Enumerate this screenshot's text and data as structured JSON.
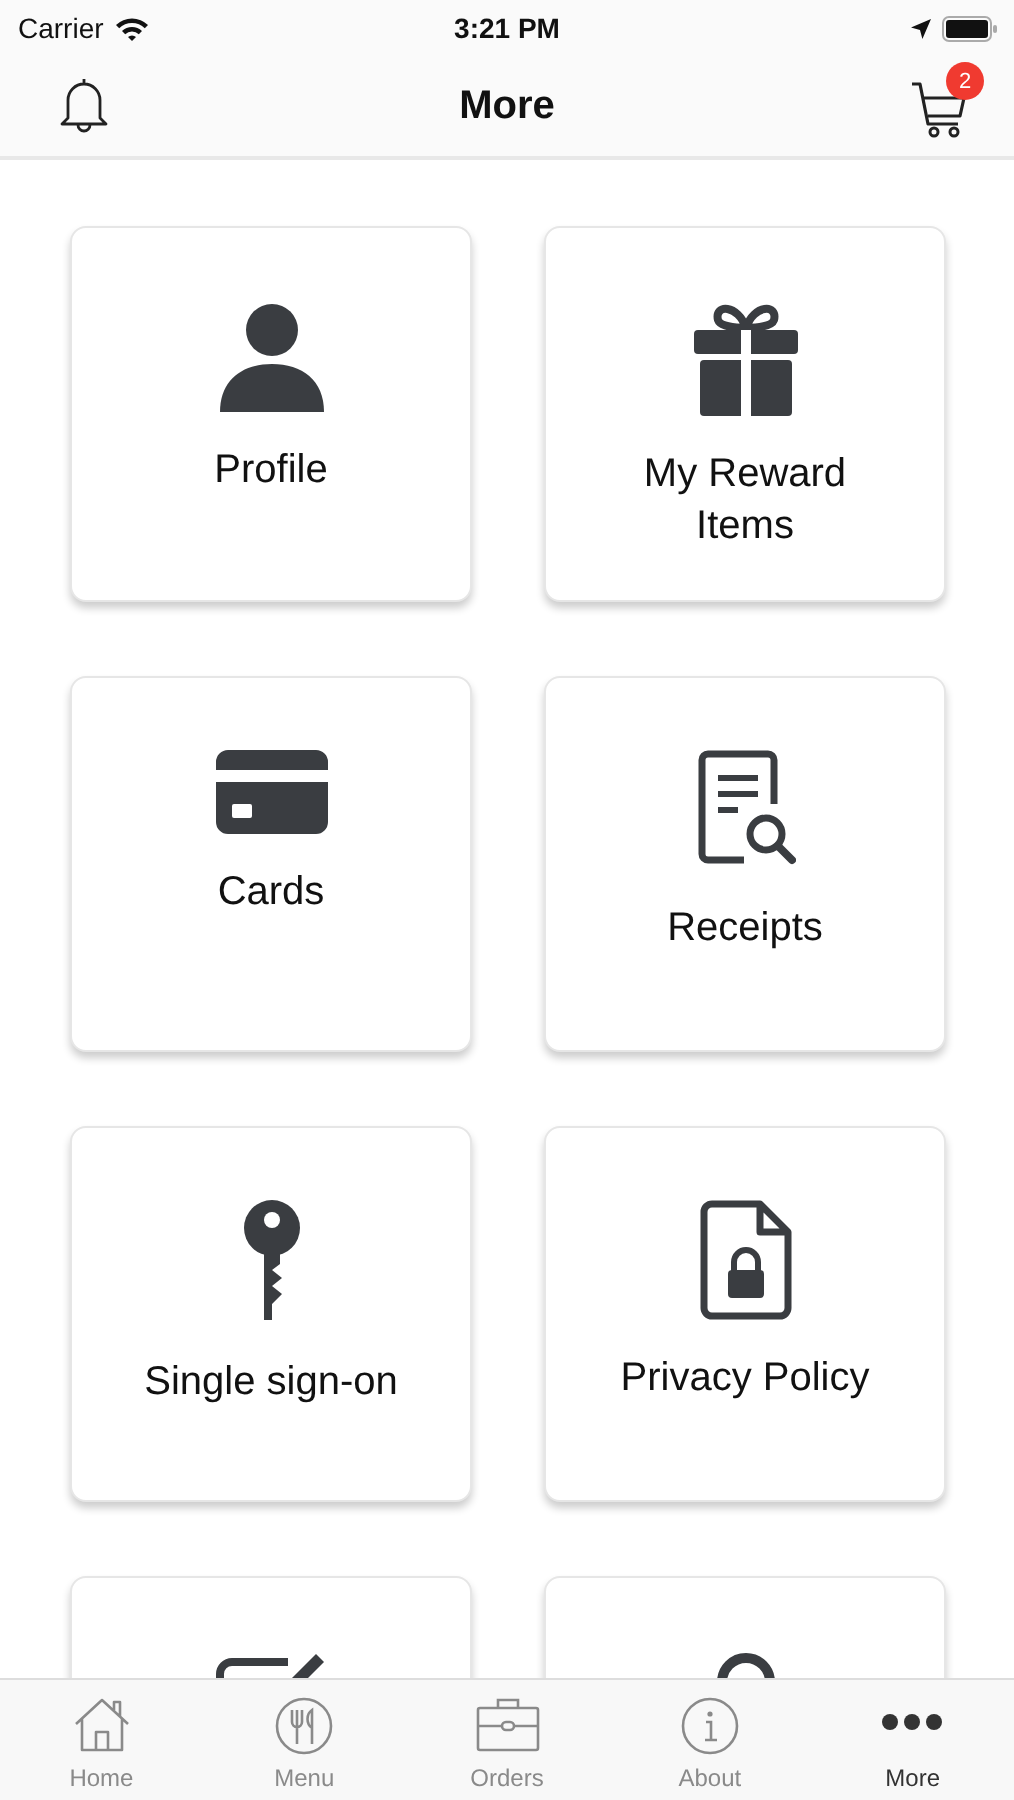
{
  "status_bar": {
    "carrier": "Carrier",
    "time": "3:21 PM"
  },
  "header": {
    "title": "More",
    "cart_count": "2"
  },
  "tiles": [
    {
      "kind": "person",
      "label": "Profile"
    },
    {
      "kind": "gift",
      "label": "My Reward Items"
    },
    {
      "kind": "card",
      "label": "Cards"
    },
    {
      "kind": "receipt",
      "label": "Receipts"
    },
    {
      "kind": "key",
      "label": "Single sign-on"
    },
    {
      "kind": "document",
      "label": "Privacy Policy"
    },
    {
      "kind": "pencil"
    },
    {
      "kind": "lock"
    }
  ],
  "tab_bar": [
    {
      "kind": "home",
      "label": "Home",
      "selected": false
    },
    {
      "kind": "menu",
      "label": "Menu",
      "selected": false
    },
    {
      "kind": "orders",
      "label": "Orders",
      "selected": false
    },
    {
      "kind": "about",
      "label": "About",
      "selected": false
    },
    {
      "kind": "more",
      "label": "More",
      "selected": true
    }
  ]
}
